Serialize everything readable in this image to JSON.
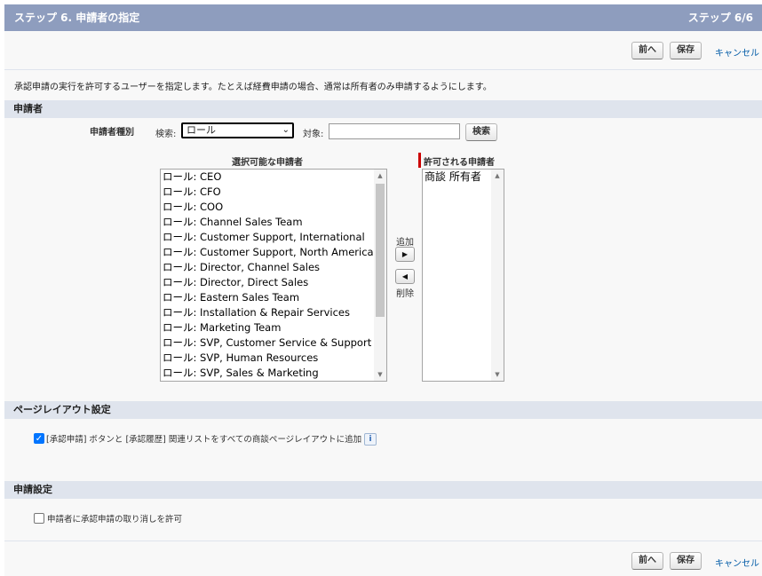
{
  "header": {
    "title": "ステップ 6. 申請者の指定",
    "step": "ステップ 6/6"
  },
  "toolbar": {
    "prev_label": "前へ",
    "save_label": "保存",
    "cancel_label": "キャンセル"
  },
  "description": "承認申請の実行を許可するユーザーを指定します。たとえば経費申請の場合、通常は所有者のみ申請するようにします。",
  "submitters": {
    "section_title": "申請者",
    "type_label": "申請者種別",
    "search_label": "検索:",
    "search_select_value": "ロール",
    "target_label": "対象:",
    "target_value": "",
    "search_button": "検索",
    "available_header": "選択可能な申請者",
    "allowed_header": "許可される申請者",
    "add_label": "追加",
    "remove_label": "削除",
    "available": [
      "ロール: CEO",
      "ロール: CFO",
      "ロール: COO",
      "ロール: Channel Sales Team",
      "ロール: Customer Support, International",
      "ロール: Customer Support, North America",
      "ロール: Director, Channel Sales",
      "ロール: Director, Direct Sales",
      "ロール: Eastern Sales Team",
      "ロール: Installation & Repair Services",
      "ロール: Marketing Team",
      "ロール: SVP, Customer Service & Support",
      "ロール: SVP, Human Resources",
      "ロール: SVP, Sales & Marketing"
    ],
    "allowed": [
      "商談 所有者"
    ]
  },
  "layout_settings": {
    "section_title": "ページレイアウト設定",
    "checkbox_label": "[承認申請] ボタンと [承認履歴] 関連リストをすべての商談ページレイアウトに追加",
    "checked": true,
    "info_icon": "i"
  },
  "submit_settings": {
    "section_title": "申請設定",
    "checkbox_label": "申請者に承認申請の取り消しを許可",
    "checked": false
  }
}
